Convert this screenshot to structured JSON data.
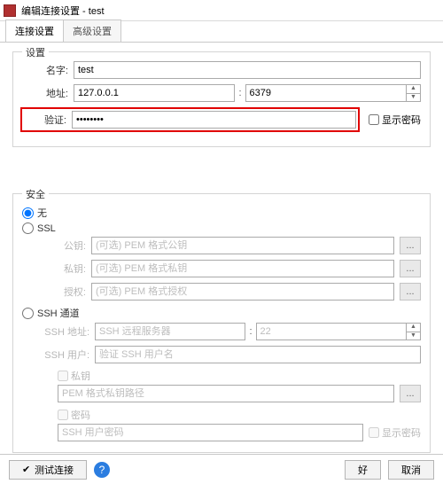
{
  "window": {
    "title": "编辑连接设置 - test"
  },
  "tabs": {
    "connect": "连接设置",
    "advanced": "高级设置"
  },
  "settings": {
    "group_title": "设置",
    "name_label": "名字:",
    "name_value": "test",
    "addr_label": "地址:",
    "addr_value": "127.0.0.1",
    "port_value": "6379",
    "auth_label": "验证:",
    "auth_value": "••••••••",
    "show_pwd": "显示密码"
  },
  "security": {
    "group_title": "安全",
    "none": "无",
    "ssl": "SSL",
    "pubkey_label": "公钥:",
    "pubkey_ph": "(可选) PEM 格式公钥",
    "privkey_label": "私钥:",
    "privkey_ph": "(可选) PEM 格式私钥",
    "authz_label": "授权:",
    "authz_ph": "(可选) PEM 格式授权",
    "ssh": "SSH 通道",
    "ssh_addr_label": "SSH 地址:",
    "ssh_addr_ph": "SSH 远程服务器",
    "ssh_port": "22",
    "ssh_user_label": "SSH 用户:",
    "ssh_user_ph": "验证 SSH 用户名",
    "ssh_priv": "私钥",
    "ssh_priv_ph": "PEM 格式私钥路径",
    "ssh_pwd": "密码",
    "ssh_pwd_ph": "SSH 用户密码",
    "show_pwd": "显示密码",
    "dots": "..."
  },
  "footer": {
    "test": "测试连接",
    "ok": "好",
    "cancel": "取消"
  }
}
